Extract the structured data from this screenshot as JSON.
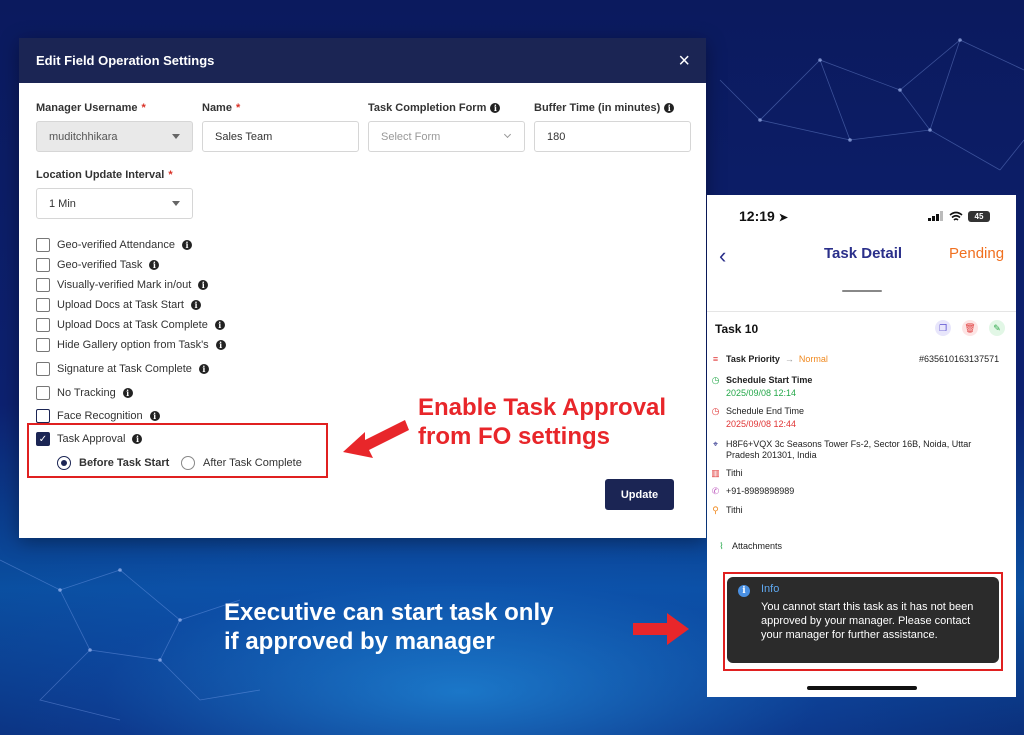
{
  "modal": {
    "title": "Edit Field Operation Settings",
    "close_icon": "×",
    "fields": {
      "manager_username": {
        "label": "Manager Username",
        "value": "muditchhikara"
      },
      "name": {
        "label": "Name",
        "value": "Sales Team"
      },
      "task_completion_form": {
        "label": "Task Completion Form",
        "placeholder": "Select Form"
      },
      "buffer_time": {
        "label": "Buffer Time (in minutes)",
        "value": "180"
      },
      "location_interval": {
        "label": "Location Update Interval",
        "value": "1 Min"
      }
    },
    "required_mark": "*",
    "checkboxes": [
      {
        "label": "Geo-verified Attendance",
        "checked": false
      },
      {
        "label": "Geo-verified Task",
        "checked": false
      },
      {
        "label": "Visually-verified Mark in/out",
        "checked": false
      },
      {
        "label": "Upload Docs at Task Start",
        "checked": false
      },
      {
        "label": "Upload Docs at Task Complete",
        "checked": false
      },
      {
        "label": "Hide Gallery option from Task's",
        "checked": false
      },
      {
        "label": "Signature at Task Complete",
        "checked": false
      },
      {
        "label": "No Tracking",
        "checked": false
      },
      {
        "label": "Face Recognition",
        "checked": false
      },
      {
        "label": "Task Approval",
        "checked": true
      }
    ],
    "approval_options": [
      {
        "label": "Before Task Start",
        "selected": true
      },
      {
        "label": "After Task Complete",
        "selected": false
      }
    ],
    "update_label": "Update"
  },
  "callouts": {
    "red_line1": "Enable Task Approval",
    "red_line2": "from FO settings",
    "white_line1": "Executive can start task only",
    "white_line2": "if approved by manager"
  },
  "phone": {
    "time": "12:19",
    "battery": "45",
    "nav_title": "Task Detail",
    "status": "Pending",
    "task_name": "Task 10",
    "task_id": "#635610163137571",
    "priority_label": "Task Priority",
    "priority_value": "Normal",
    "start_label": "Schedule Start Time",
    "start_value": "2025/09/08 12:14",
    "end_label": "Schedule End Time",
    "end_value": "2025/09/08 12:44",
    "address_line1": "H8F6+VQX 3c Seasons Tower Fs-2, Sector 16B, Noida, Uttar",
    "address_line2": "Pradesh 201301, India",
    "company": "Tithi",
    "phone": "+91-8989898989",
    "contact": "Tithi",
    "attachments": "Attachments",
    "toast_title": "Info",
    "toast_message": "You cannot start this task as it has not been approved by your manager. Please contact your manager for further assistance."
  },
  "colors": {
    "header_navy": "#1b2554",
    "accent_red": "#e8262a",
    "pending_orange": "#f07020",
    "priority_orange": "#f08a20"
  }
}
